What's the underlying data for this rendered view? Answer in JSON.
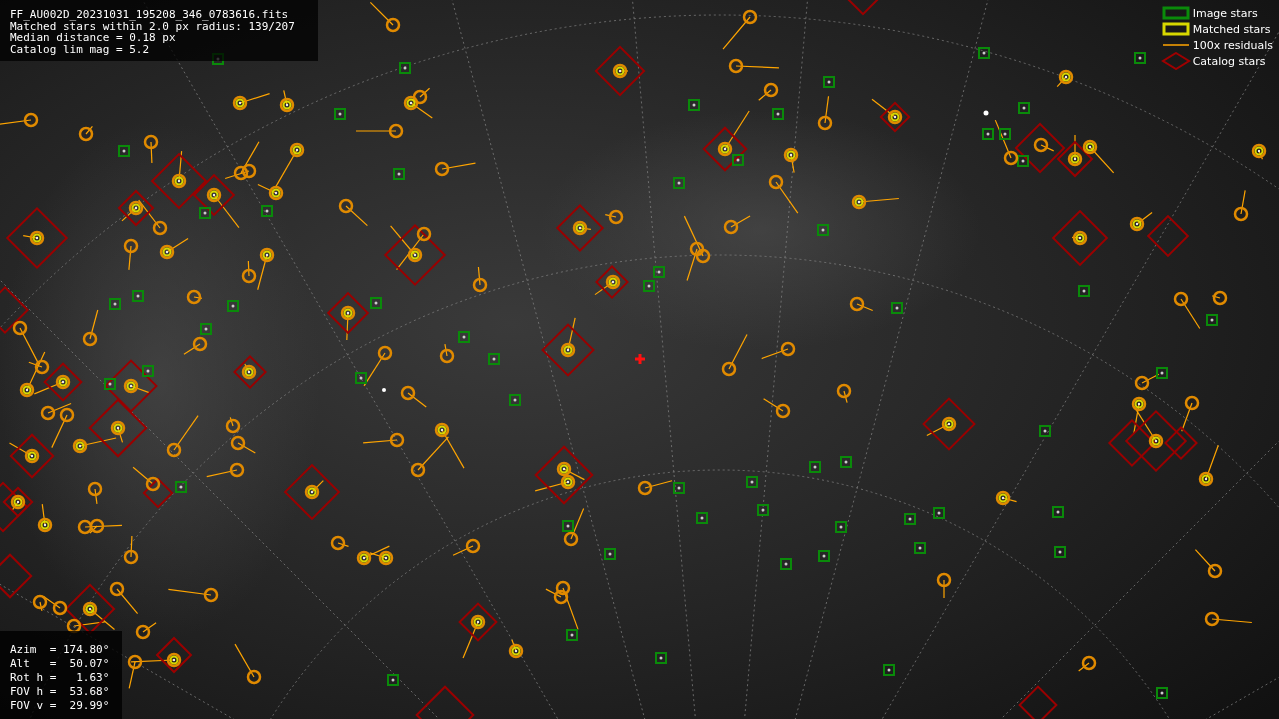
{
  "info_box": {
    "lines": [
      "FF_AU002D_20231031_195208_346_0783616.fits",
      "Matched stars within 2.0 px radius: 139/207",
      "Median distance = 0.18 px",
      "Catalog lim mag = 5.2"
    ]
  },
  "legend": [
    {
      "kind": "image",
      "label": "Image stars"
    },
    {
      "kind": "matched",
      "label": "Matched stars"
    },
    {
      "kind": "residual",
      "label": "100x residuals"
    },
    {
      "kind": "catalog",
      "label": "Catalog stars"
    }
  ],
  "pointing_box": {
    "lines": [
      "Azim  = 174.80°",
      "Alt   =  50.07°",
      "Rot h =   1.63°",
      "FOV h =  53.68°",
      "FOV v =  29.99°"
    ]
  }
}
